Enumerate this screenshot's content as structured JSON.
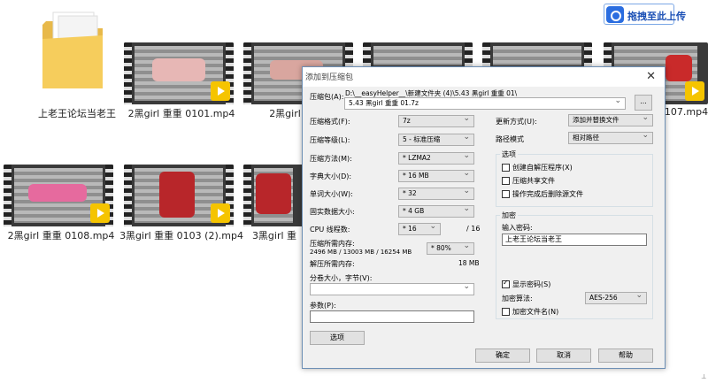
{
  "desktop": {
    "upload_button": "拖拽至此上传",
    "files": [
      {
        "name": "上老王论坛当老王",
        "kind": "folder"
      },
      {
        "name": "2黑girl 重重 0101.mp4",
        "kind": "video",
        "badge": "Player"
      },
      {
        "name": "2黑girl 重重 0",
        "kind": "video",
        "badge": "Player"
      },
      {
        "name": "",
        "kind": "video",
        "badge": ""
      },
      {
        "name": "",
        "kind": "video",
        "badge": ""
      },
      {
        "name": "0107.mp4",
        "kind": "video",
        "badge": "Player"
      },
      {
        "name": "2黑girl 重重 0108.mp4",
        "kind": "video",
        "badge": "Player"
      },
      {
        "name": "3黑girl 重重 0103 (2).mp4",
        "kind": "video",
        "badge": "Player"
      },
      {
        "name": "3黑girl 重",
        "kind": "video",
        "badge": "Player"
      }
    ]
  },
  "dialog": {
    "title": "添加到压缩包",
    "archive_label": "压缩包(A):",
    "archive_path": "D:\\__easyHelper__\\新建文件夹 (4)\\5.43 黑girl 重重 01\\",
    "archive_name": "5.43 黑girl 重重 01.7z",
    "browse_label": "...",
    "format_label": "压缩格式(F):",
    "format_value": "7z",
    "level_label": "压缩等级(L):",
    "level_value": "5 - 标准压缩",
    "method_label": "压缩方法(M):",
    "method_value": "* LZMA2",
    "dict_label": "字典大小(D):",
    "dict_value": "* 16 MB",
    "word_label": "单词大小(W):",
    "word_value": "* 32",
    "solid_label": "固实数据大小:",
    "solid_value": "* 4 GB",
    "cpu_label": "CPU 线程数:",
    "cpu_value": "* 16",
    "cpu_total": "/ 16",
    "mem_label": "压缩所需内存:",
    "mem_value": "2496 MB / 13003 MB / 16254 MB",
    "mem_pct": "* 80%",
    "decomp_label": "解压所需内存:",
    "decomp_value": "18 MB",
    "split_label": "分卷大小，字节(V):",
    "split_value": "",
    "params_label": "参数(P):",
    "params_value": "",
    "options_button": "选项",
    "update_label": "更新方式(U):",
    "update_value": "添加并替换文件",
    "path_label": "路径模式",
    "path_value": "相对路径",
    "options_group": "选项",
    "opt_sfx": "创建自解压程序(X)",
    "opt_shared": "压缩共享文件",
    "opt_delete": "操作完成后删除源文件",
    "enc_group": "加密",
    "enc_pwd_label": "输入密码:",
    "enc_pwd_value": "上老王论坛当老王",
    "enc_show": "显示密码(S)",
    "enc_method_label": "加密算法:",
    "enc_method_value": "AES-256",
    "enc_names": "加密文件名(N)",
    "ok": "确定",
    "cancel": "取消",
    "help": "帮助"
  }
}
